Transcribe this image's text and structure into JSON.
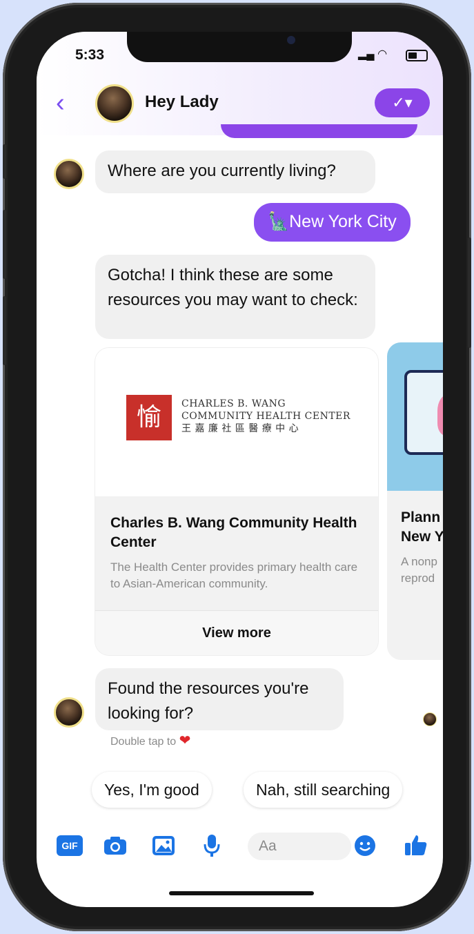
{
  "status_bar": {
    "time": "5:33"
  },
  "header": {
    "title": "Hey Lady",
    "check_label": "✓▾"
  },
  "messages": {
    "question": "Where are you currently living?",
    "answer": "🗽New York City",
    "resources_intro": "Gotcha! I think these are some resources you may want to check:",
    "followup": "Found the resources you're looking for?",
    "hint": "Double tap to",
    "hint_heart": "❤"
  },
  "cards": [
    {
      "logo_mark": "愉",
      "logo_line1": "CHARLES B. WANG",
      "logo_line2": "COMMUNITY HEALTH CENTER",
      "logo_line3": "王 嘉 廉 社 區 醫 療 中 心",
      "title": "Charles B. Wang Community Health Center",
      "description": "The Health Center provides primary health care to Asian-American community.",
      "button": "View more"
    },
    {
      "title_line1": "Plann",
      "title_line2": "New Y",
      "desc_line1": "A nonp",
      "desc_line2": "reprod"
    }
  ],
  "quick_replies": [
    "Yes, I'm good",
    "Nah, still searching"
  ],
  "composer": {
    "placeholder": "Aa",
    "gif_label": "GIF"
  },
  "colors": {
    "accent": "#8b45e8",
    "messenger_blue": "#1b74e4"
  }
}
